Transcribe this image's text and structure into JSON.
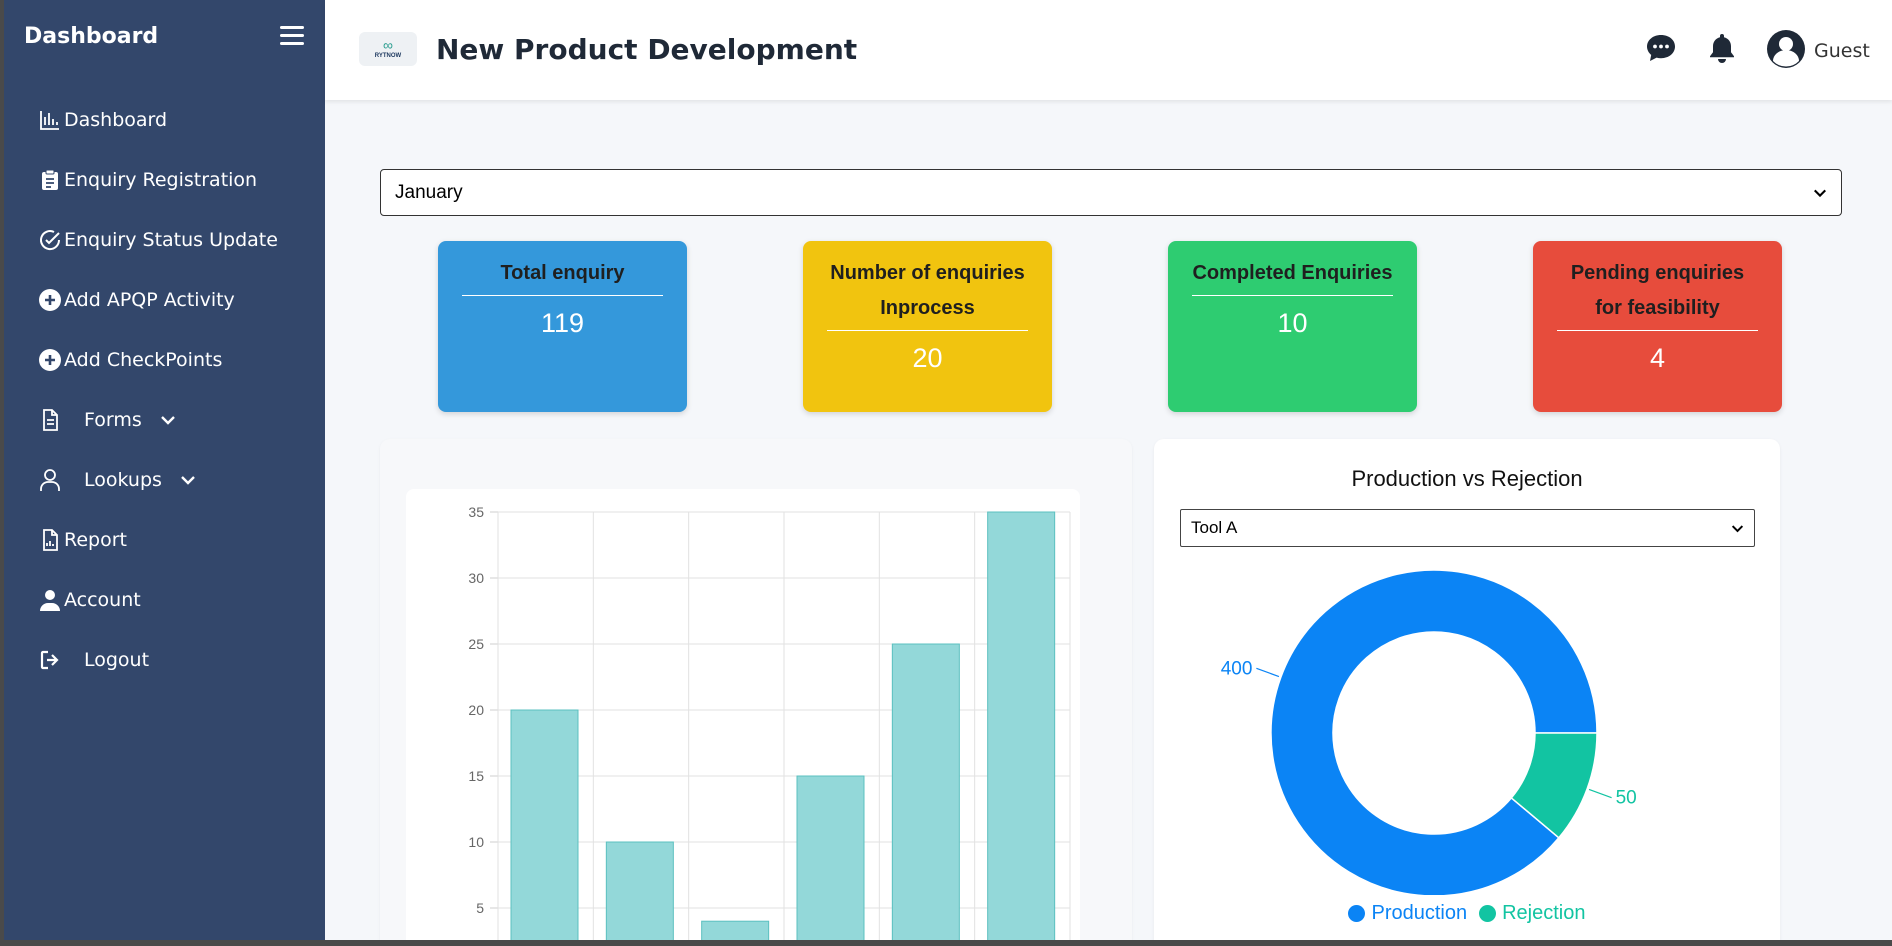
{
  "sidebar": {
    "brand": "Dashboard",
    "items": [
      {
        "label": "Dashboard",
        "icon": "bar-chart-icon"
      },
      {
        "label": "Enquiry Registration",
        "icon": "clipboard-icon"
      },
      {
        "label": "Enquiry Status Update",
        "icon": "check-circle-icon"
      },
      {
        "label": "Add APQP Activity",
        "icon": "plus-circle-icon"
      },
      {
        "label": "Add CheckPoints",
        "icon": "plus-circle-icon"
      },
      {
        "label": "Forms",
        "icon": "document-icon"
      },
      {
        "label": "Lookups",
        "icon": "user-outline-icon"
      },
      {
        "label": "Report",
        "icon": "report-icon"
      },
      {
        "label": "Account",
        "icon": "user-icon"
      },
      {
        "label": "Logout",
        "icon": "logout-icon"
      }
    ]
  },
  "header": {
    "logo_text": "RYTNOW",
    "title": "New Product Development",
    "user_name": "Guest"
  },
  "filters": {
    "month": "January",
    "tool": "Tool A"
  },
  "cards": [
    {
      "label": "Total enquiry",
      "value": "119",
      "color": "#3498db"
    },
    {
      "label": "Number of enquiries Inprocess",
      "value": "20",
      "color": "#f1c40f"
    },
    {
      "label": "Completed Enquiries",
      "value": "10",
      "color": "#2ecc71"
    },
    {
      "label": "Pending enquiries for feasibility",
      "value": "4",
      "color": "#e74c3c"
    }
  ],
  "colors": {
    "sidebar_bg": "#33476b",
    "bar_fill": "#93d8d9",
    "bar_stroke": "#5bc0c0",
    "production": "#0b84f5",
    "rejection": "#12c4a2"
  },
  "chart_data": [
    {
      "type": "bar",
      "categories": [
        "",
        "",
        "",
        "",
        "",
        ""
      ],
      "values": [
        20,
        10,
        4,
        15,
        25,
        35
      ],
      "yticks": [
        "5",
        "10",
        "15",
        "20",
        "25",
        "30",
        "35"
      ],
      "ylim": [
        0,
        35
      ],
      "grid": true
    },
    {
      "type": "pie",
      "title": "Production vs Rejection",
      "labels": [
        "Production",
        "Rejection"
      ],
      "values": [
        400,
        50
      ],
      "data_labels": [
        "400",
        "50"
      ],
      "legend": "bottom"
    }
  ]
}
